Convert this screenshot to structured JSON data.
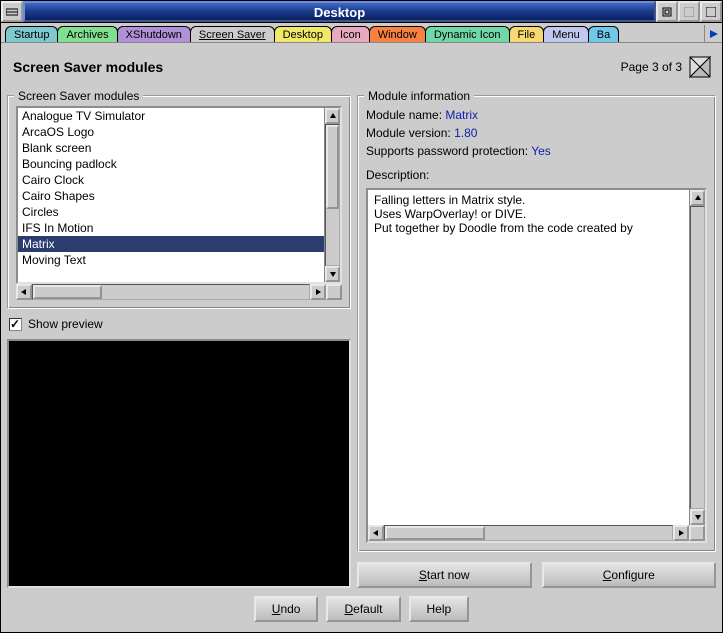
{
  "window": {
    "title": "Desktop"
  },
  "tabs": [
    {
      "label": "Startup",
      "color": "#7ec8d0"
    },
    {
      "label": "Archives",
      "color": "#80e090"
    },
    {
      "label": "XShutdown",
      "color": "#b090d8"
    },
    {
      "label": "Screen Saver",
      "color": "#cccccc",
      "active": true
    },
    {
      "label": "Desktop",
      "color": "#f0e868"
    },
    {
      "label": "Icon",
      "color": "#e8a8c0"
    },
    {
      "label": "Window",
      "color": "#f88040"
    },
    {
      "label": "Dynamic Icon",
      "color": "#70d8a8"
    },
    {
      "label": "File",
      "color": "#f8d870"
    },
    {
      "label": "Menu",
      "color": "#c0c8f0"
    },
    {
      "label": "Ba",
      "color": "#70c8e8"
    }
  ],
  "page": {
    "heading": "Screen Saver modules",
    "page_of": "Page 3 of 3"
  },
  "modules_group_label": "Screen Saver modules",
  "modules": [
    "Analogue TV Simulator",
    "ArcaOS Logo",
    "Blank screen",
    "Bouncing padlock",
    "Cairo Clock",
    "Cairo Shapes",
    "Circles",
    "IFS In Motion",
    "Matrix",
    "Moving Text"
  ],
  "selected_module_index": 8,
  "show_preview": {
    "label": "Show preview",
    "checked": true
  },
  "info_group_label": "Module information",
  "info": {
    "name_label": "Module name:",
    "name_value": "Matrix",
    "version_label": "Module version:",
    "version_value": "1.80",
    "pwd_label": "Supports password protection:",
    "pwd_value": "Yes",
    "desc_label": "Description:",
    "desc_lines": [
      "Falling letters in Matrix style.",
      "Uses WarpOverlay! or DIVE.",
      "Put together by Doodle from the code created by"
    ]
  },
  "buttons": {
    "start": "Start now",
    "configure": "Configure"
  },
  "footer": {
    "undo": "Undo",
    "default": "Default",
    "help": "Help"
  }
}
